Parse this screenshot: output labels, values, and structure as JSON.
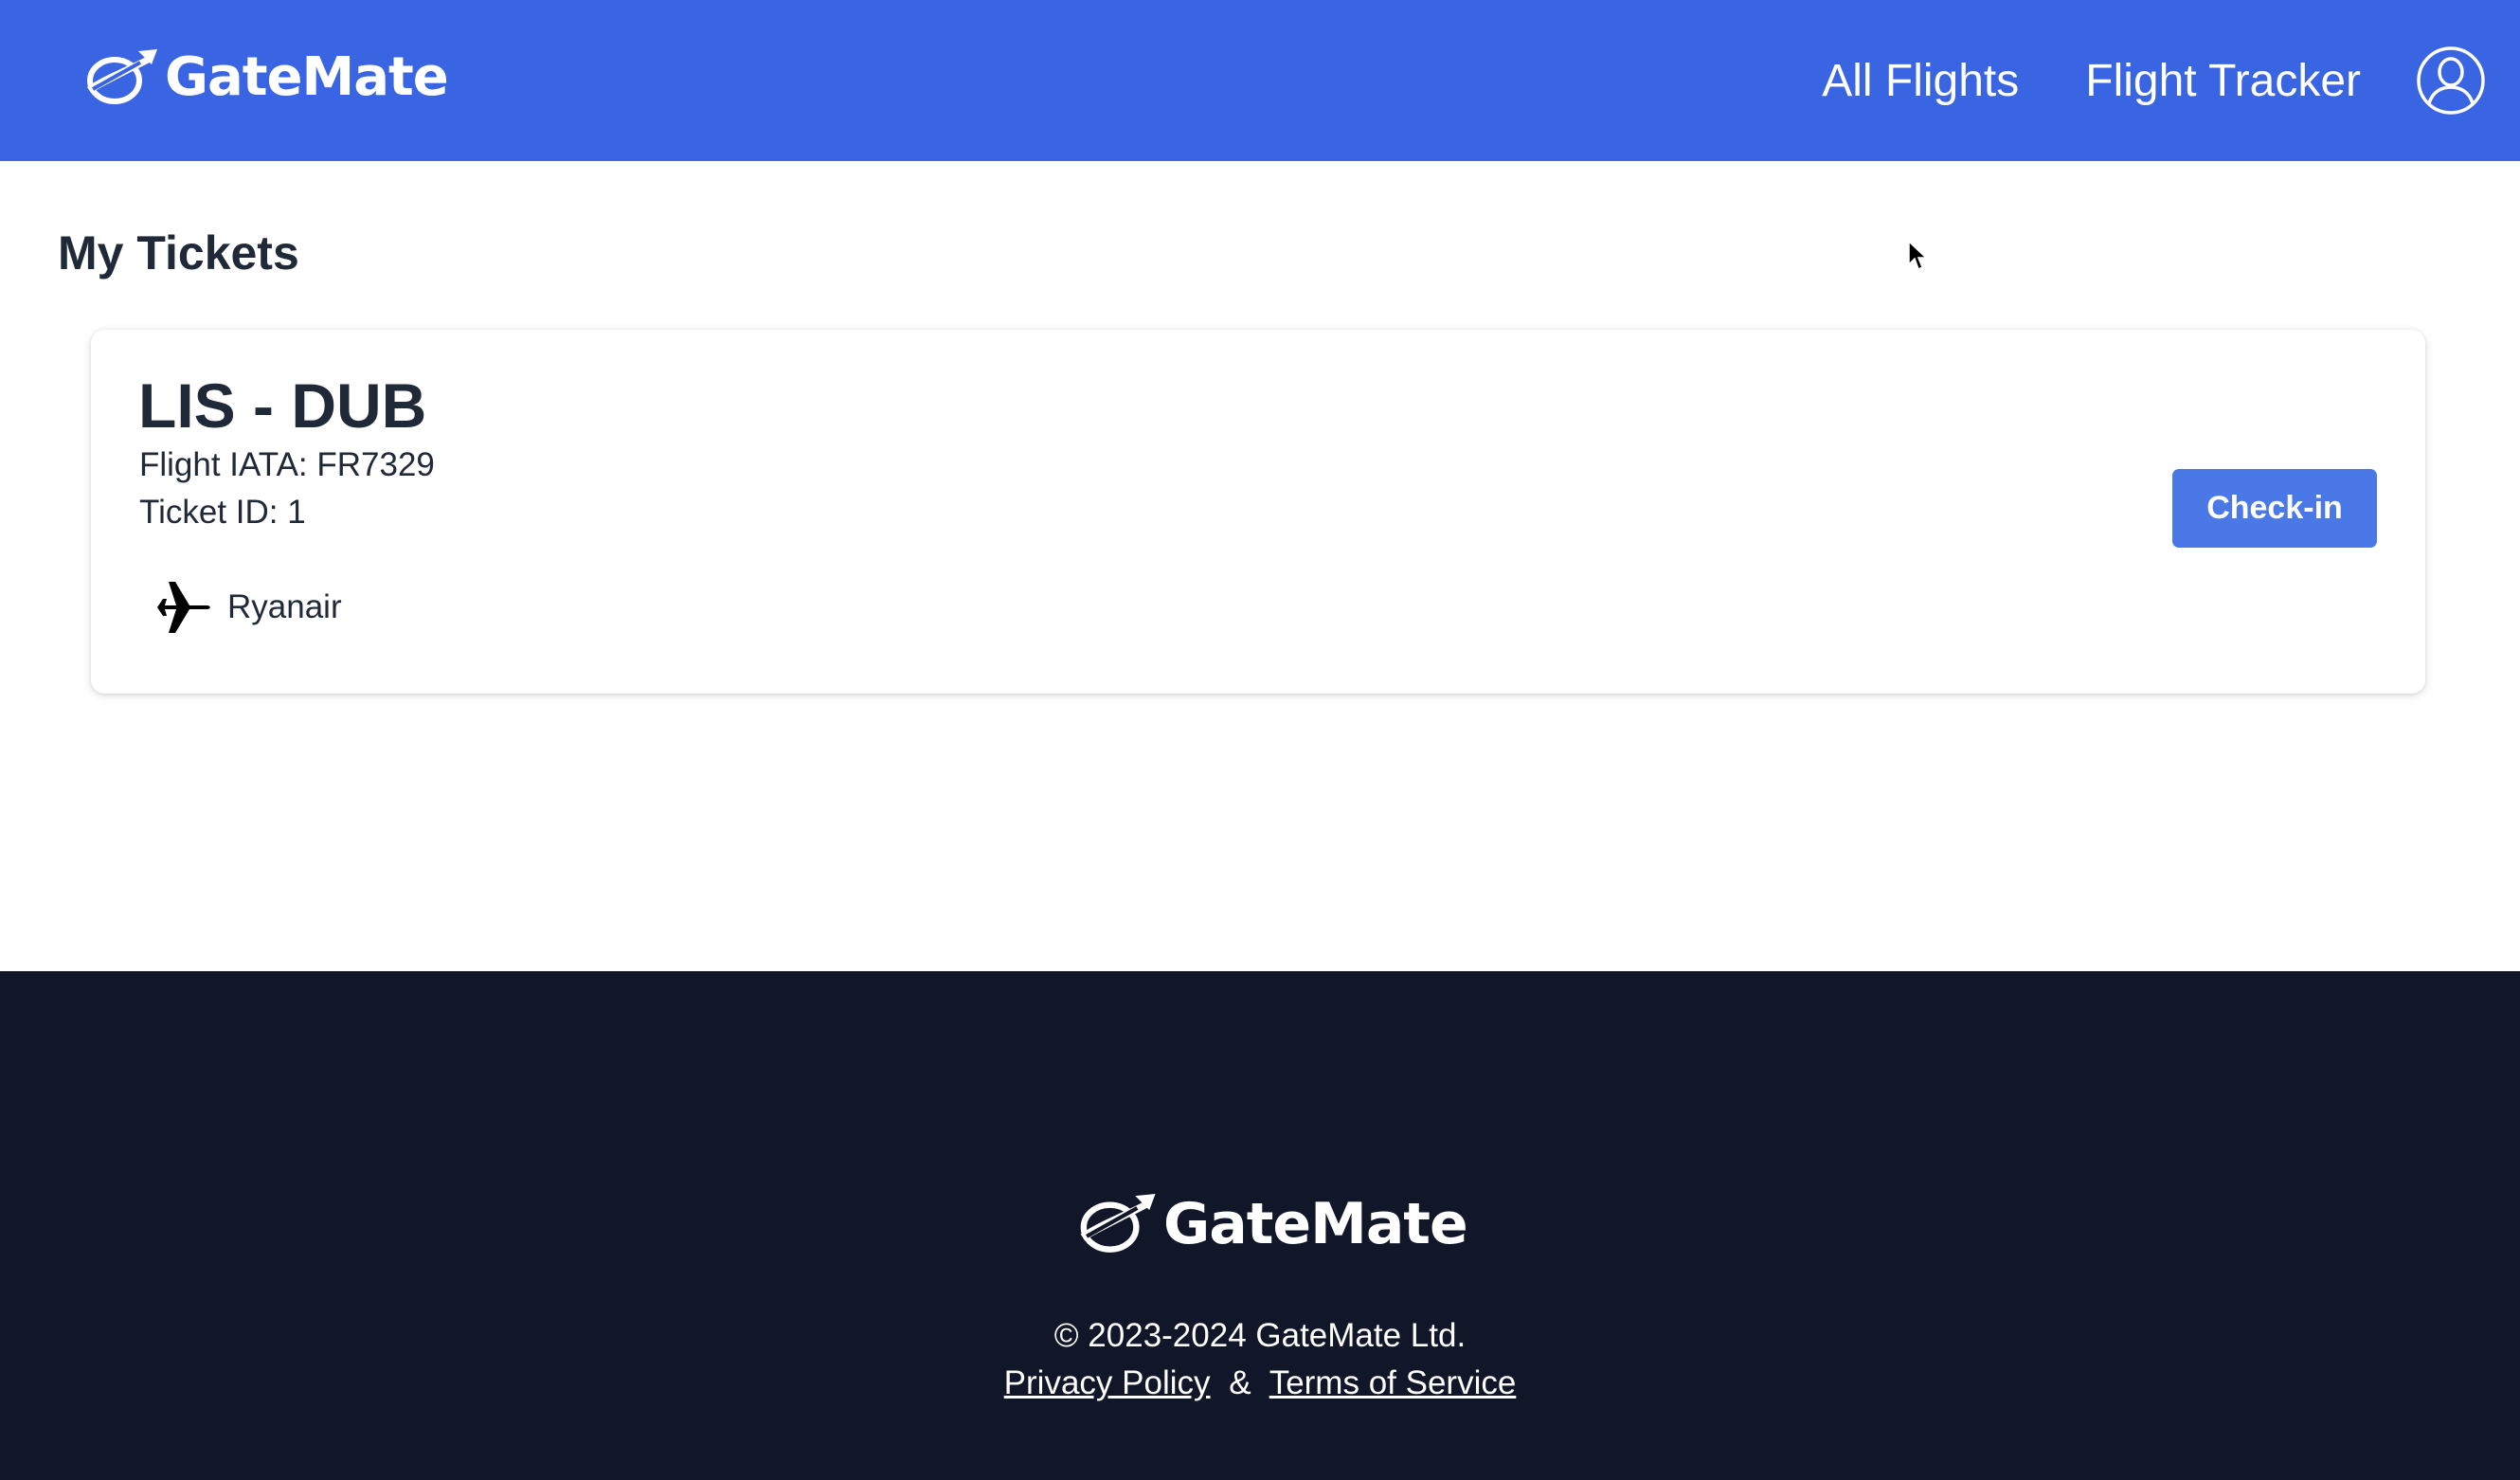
{
  "header": {
    "brand_name": "GateMate",
    "brand_icon": "plane-orbit-logo-icon",
    "nav": [
      {
        "label": "All Flights"
      },
      {
        "label": "Flight Tracker"
      }
    ],
    "profile_icon": "user-profile-icon"
  },
  "main": {
    "title": "My Tickets",
    "tickets": [
      {
        "route": "LIS - DUB",
        "flight_iata": "Flight IATA: FR7329",
        "ticket_id": "Ticket ID: 1",
        "airline_icon": "airplane-icon",
        "airline": "Ryanair",
        "action_label": "Check-in"
      }
    ]
  },
  "footer": {
    "brand_name": "GateMate",
    "copyright": "© 2023-2024 GateMate Ltd.",
    "privacy_label": "Privacy Policy",
    "separator": "&",
    "terms_label": "Terms of Service"
  },
  "colors": {
    "header_bg": "#3a65e2",
    "button_bg": "#4a78e6",
    "footer_bg": "#111729",
    "text_dark": "#1f2937"
  }
}
